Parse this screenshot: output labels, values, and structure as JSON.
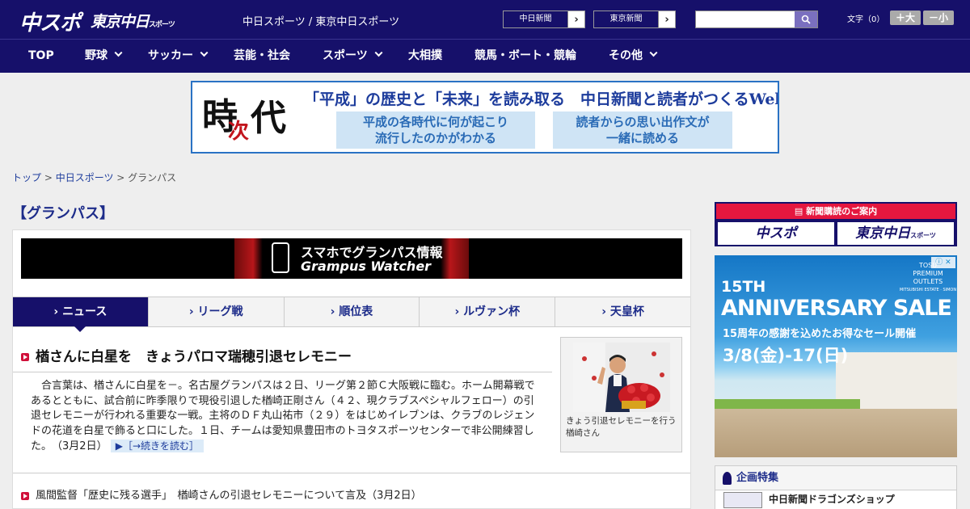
{
  "header": {
    "logo_chuspo": "中スポ",
    "logo_tokyo": "東京中日",
    "logo_tokyo_sub": "スポーツ",
    "site_title": "中日スポーツ / 東京中日スポーツ",
    "paper_links": [
      "中日新聞",
      "東京新聞"
    ],
    "search_placeholder": "",
    "font_size_label": "文字（0）",
    "font_larger": "＋大",
    "font_smaller": "－小"
  },
  "nav": {
    "items": [
      {
        "label": "TOP",
        "has_menu": false
      },
      {
        "label": "野球",
        "has_menu": true
      },
      {
        "label": "サッカー",
        "has_menu": true
      },
      {
        "label": "芸能・社会",
        "has_menu": false
      },
      {
        "label": "スポーツ",
        "has_menu": true
      },
      {
        "label": "大相撲",
        "has_menu": false
      },
      {
        "label": "競馬・ボート・競輪",
        "has_menu": false
      },
      {
        "label": "その他",
        "has_menu": true
      }
    ]
  },
  "banner": {
    "kanji1": "時",
    "kanji2": "次",
    "kanji3": "代",
    "headline": "「平成」の歴史と「未来」を読み取る　中日新聞と読者がつくるWebサイト",
    "box1_line1": "平成の各時代に何が起こり",
    "box1_line2": "流行したのかがわかる",
    "box2_line1": "読者からの思い出作文が",
    "box2_line2": "一緒に読める"
  },
  "breadcrumb": {
    "items": [
      "トップ",
      "中日スポーツ"
    ],
    "current": "グランパス",
    "separator": " > "
  },
  "main": {
    "page_title": "【グランパス】",
    "grampus_banner_line1": "スマホでグランパス情報",
    "grampus_banner_line2": "Grampus Watcher",
    "tabs": [
      {
        "label": "ニュース",
        "active": true
      },
      {
        "label": "リーグ戦",
        "active": false
      },
      {
        "label": "順位表",
        "active": false
      },
      {
        "label": "ルヴァン杯",
        "active": false
      },
      {
        "label": "天皇杯",
        "active": false
      }
    ],
    "tab_arrow": "›",
    "article": {
      "title": "楢さんに白星を　きょうパロマ瑞穂引退セレモニー",
      "body": "合言葉は、楢さんに白星を－。名古屋グランパスは２日、リーグ第２節Ｃ大阪戦に臨む。ホーム開幕戦であるとともに、試合前に昨季限りで現役引退した楢崎正剛さん（４２、現クラブスペシャルフェロー）の引退セレモニーが行われる重要な一戦。主将のＤＦ丸山祐市（２９）をはじめイレブンは、クラブのレジェンドの花道を白星で飾ると口にした。１日、チームは愛知県豊田市のトヨタスポーツセンターで非公開練習した。",
      "date": "（3月2日）",
      "read_more": "▶［→続きを読む］",
      "photo_caption": "きょう引退セレモニーを行う楢崎さん"
    },
    "news_items": [
      {
        "title": "風間監督「歴史に残る選手」　楢崎さんの引退セレモニーについて言及",
        "date": "（3月2日）"
      }
    ]
  },
  "sidebar": {
    "subscription_title": "新聞購読のご案内",
    "sub_btn1": "中スポ",
    "sub_btn2": "東京中日",
    "sub_btn2_small": "スポーツ",
    "ad": {
      "brand_line1": "TOSU",
      "brand_line2": "PREMIUM OUTLETS",
      "brand_line3": "MITSUBISHI ESTATE · SIMON",
      "line1": "15TH",
      "line2": "ANNIVERSARY SALE",
      "line3": "15周年の感謝を込めたお得なセール開催",
      "line4": "3/8(金)-17(日)",
      "adchoices": "ⓘ ✕"
    },
    "feature_title": "企画特集",
    "feature_item": "中日新聞ドラゴンズショップ"
  },
  "colors": {
    "header_bg": "#16106a",
    "accent_red": "#e5173f",
    "link_blue": "#1d3c9c",
    "banner_border": "#2a72c4"
  }
}
